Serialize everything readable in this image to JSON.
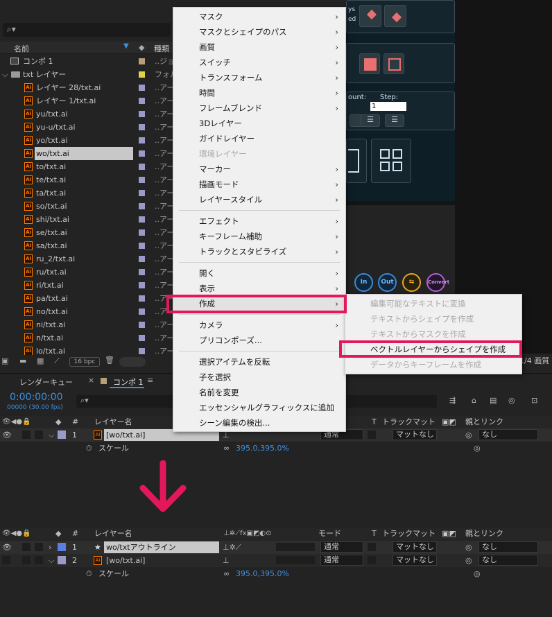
{
  "project": {
    "col_name": "名前",
    "col_type": "種類",
    "items": [
      {
        "name": "コンポ 1",
        "type": "..ジョ",
        "label": "#b5a07a",
        "indent": 1,
        "icon": "comp"
      },
      {
        "name": "txt レイヤー",
        "type": "フォル",
        "label": "#e0d445",
        "indent": 1,
        "icon": "folder"
      },
      {
        "name": "レイヤー 28/txt.ai",
        "type": "..アー",
        "label": "#9a9ac8",
        "icon": "ai"
      },
      {
        "name": "レイヤー 1/txt.ai",
        "type": "..アー",
        "label": "#9a9ac8",
        "icon": "ai"
      },
      {
        "name": "yu/txt.ai",
        "type": "..アー",
        "label": "#9a9ac8",
        "icon": "ai"
      },
      {
        "name": "yu-u/txt.ai",
        "type": "..アー",
        "label": "#9a9ac8",
        "icon": "ai"
      },
      {
        "name": "yo/txt.ai",
        "type": "..アー",
        "label": "#9a9ac8",
        "icon": "ai"
      },
      {
        "name": "wo/txt.ai",
        "type": "..アー",
        "label": "#9a9ac8",
        "icon": "ai",
        "selected": true
      },
      {
        "name": "to/txt.ai",
        "type": "..アー",
        "label": "#9a9ac8",
        "icon": "ai"
      },
      {
        "name": "te/txt.ai",
        "type": "..アー",
        "label": "#9a9ac8",
        "icon": "ai"
      },
      {
        "name": "ta/txt.ai",
        "type": "..アー",
        "label": "#9a9ac8",
        "icon": "ai"
      },
      {
        "name": "so/txt.ai",
        "type": "..アー",
        "label": "#9a9ac8",
        "icon": "ai"
      },
      {
        "name": "shi/txt.ai",
        "type": "..アー",
        "label": "#9a9ac8",
        "icon": "ai"
      },
      {
        "name": "se/txt.ai",
        "type": "..アー",
        "label": "#9a9ac8",
        "icon": "ai"
      },
      {
        "name": "sa/txt.ai",
        "type": "..アー",
        "label": "#9a9ac8",
        "icon": "ai"
      },
      {
        "name": "ru_2/txt.ai",
        "type": "..アー",
        "label": "#9a9ac8",
        "icon": "ai"
      },
      {
        "name": "ru/txt.ai",
        "type": "..アー",
        "label": "#9a9ac8",
        "icon": "ai"
      },
      {
        "name": "ri/txt.ai",
        "type": "..アー",
        "label": "#9a9ac8",
        "icon": "ai"
      },
      {
        "name": "pa/txt.ai",
        "type": "..アー",
        "label": "#9a9ac8",
        "icon": "ai"
      },
      {
        "name": "no/txt.ai",
        "type": "..アー",
        "label": "#9a9ac8",
        "icon": "ai"
      },
      {
        "name": "ni/txt.ai",
        "type": "..アー",
        "label": "#9a9ac8",
        "icon": "ai"
      },
      {
        "name": "n/txt.ai",
        "type": "..アー",
        "label": "#9a9ac8",
        "icon": "ai"
      },
      {
        "name": "lo/txt.ai",
        "type": "..アー",
        "label": "#9a9ac8",
        "icon": "ai"
      }
    ],
    "bpc": "16 bpc"
  },
  "menu": {
    "items": [
      {
        "label": "マスク",
        "arrow": true
      },
      {
        "label": "マスクとシェイプのパス",
        "arrow": true
      },
      {
        "label": "画質",
        "arrow": true
      },
      {
        "label": "スイッチ",
        "arrow": true
      },
      {
        "label": "トランスフォーム",
        "arrow": true
      },
      {
        "label": "時間",
        "arrow": true
      },
      {
        "label": "フレームブレンド",
        "arrow": true
      },
      {
        "label": "3Dレイヤー",
        "arrow": false
      },
      {
        "label": "ガイドレイヤー",
        "arrow": false
      },
      {
        "label": "環境レイヤー",
        "arrow": false,
        "disabled": true
      },
      {
        "label": "マーカー",
        "arrow": true
      },
      {
        "label": "描画モード",
        "arrow": true
      },
      {
        "label": "レイヤースタイル",
        "arrow": true
      },
      {
        "sep": true
      },
      {
        "label": "エフェクト",
        "arrow": true
      },
      {
        "label": "キーフレーム補助",
        "arrow": true
      },
      {
        "label": "トラックとスタビライズ",
        "arrow": true
      },
      {
        "sep": true
      },
      {
        "label": "開く",
        "arrow": true
      },
      {
        "label": "表示",
        "arrow": true
      },
      {
        "label": "作成",
        "arrow": true,
        "active": true
      },
      {
        "sep": true
      },
      {
        "label": "カメラ",
        "arrow": true
      },
      {
        "label": "プリコンポーズ...",
        "arrow": false
      },
      {
        "sep": true
      },
      {
        "label": "選択アイテムを反転",
        "arrow": false
      },
      {
        "label": "子を選択",
        "arrow": false
      },
      {
        "label": "名前を変更",
        "arrow": false
      },
      {
        "label": "エッセンシャルグラフィックスに追加",
        "arrow": false
      },
      {
        "label": "シーン編集の検出...",
        "arrow": false
      }
    ],
    "submenu": [
      {
        "label": "編集可能なテキストに変換",
        "disabled": true
      },
      {
        "label": "テキストからシェイプを作成",
        "disabled": true
      },
      {
        "label": "テキストからマスクを作成",
        "disabled": true
      },
      {
        "label": "ベクトルレイヤーからシェイプを作成",
        "disabled": false,
        "highlight": true
      },
      {
        "label": "データからキーフレームを作成",
        "disabled": true
      }
    ]
  },
  "tabs": {
    "render": "レンダーキュー",
    "comp": "コンポ 1",
    "page": "1/4 画質"
  },
  "timeline": {
    "timecode": "0:00:00:00",
    "fps": "00000 (30.00 fps)",
    "col_layer": "レイヤー名",
    "col_mode": "モード",
    "col_track": "トラックマット",
    "col_parent": "親とリンク",
    "col_num": "#",
    "col_t": "T",
    "before": [
      {
        "num": "1",
        "name": "[wo/txt.ai]",
        "mode": "通常",
        "track": "マットなし",
        "parent": "なし"
      }
    ],
    "scale_label": "スケール",
    "scale_value": "395.0,395.0%",
    "after": [
      {
        "num": "1",
        "name": "wo/txtアウトライン",
        "mode": "通常",
        "track": "マットなし",
        "parent": "なし",
        "label": "#5b7fe0"
      },
      {
        "num": "2",
        "name": "[wo/txt.ai]",
        "mode": "通常",
        "track": "マットなし",
        "parent": "なし",
        "label": "#9a9ac8"
      }
    ]
  },
  "side": {
    "count_label": "ount:",
    "step_label": "Step:",
    "step_value": "1",
    "in": "In",
    "out": "Out",
    "convert": "Convert",
    "ys": "ys",
    "ed": "ed"
  },
  "colors": {
    "highlight": "#e2185b",
    "timecode": "#3f8fe0",
    "scale": "#3f8fe0"
  }
}
